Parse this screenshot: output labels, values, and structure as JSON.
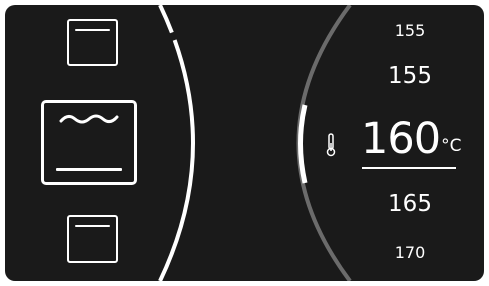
{
  "oven_modes": {
    "items": [
      {
        "name": "standard-mode",
        "icon": "oven-top-bottom-heat-icon"
      },
      {
        "name": "grill-mode",
        "icon": "oven-grill-icon",
        "selected": true
      },
      {
        "name": "bottom-heat-mode",
        "icon": "oven-bottom-heat-icon"
      }
    ]
  },
  "temperature": {
    "scroll_values": [
      "155",
      "155",
      "160",
      "165",
      "170"
    ],
    "above_2": "155",
    "above_1": "155",
    "selected_value": "160",
    "unit": "°C",
    "below_1": "165",
    "below_2": "170",
    "thermometer_icon": "thermometer-icon"
  },
  "colors": {
    "background": "#1a1a1a",
    "foreground": "#ffffff",
    "track": "#6b6b6b"
  }
}
